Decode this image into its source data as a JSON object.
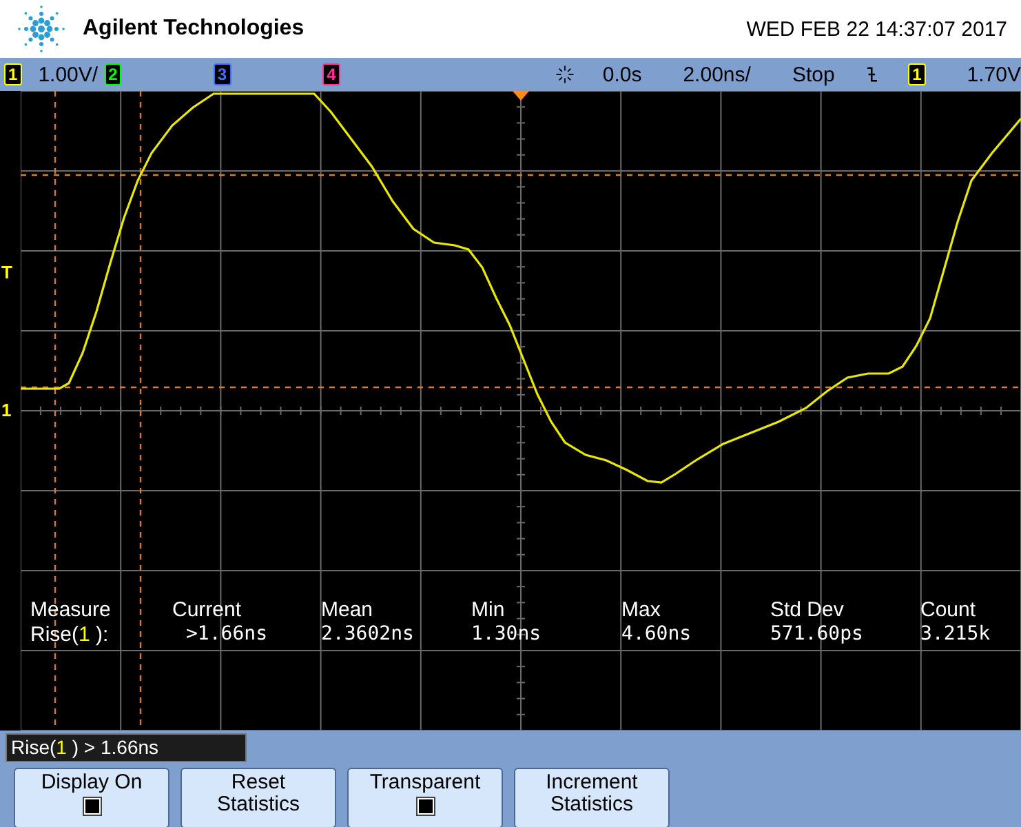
{
  "header": {
    "brand": "Agilent Technologies",
    "datetime": "WED FEB 22 14:37:07 2017"
  },
  "status_bar": {
    "channels": [
      {
        "label": "1",
        "color": "#ffff00",
        "scale": "1.00V/"
      },
      {
        "label": "2",
        "color": "#00ff00"
      },
      {
        "label": "3",
        "color": "#3b6cff"
      },
      {
        "label": "4",
        "color": "#ff2e9a"
      }
    ],
    "delay": "0.0s",
    "timebase": "2.00ns/",
    "run_state": "Stop",
    "trigger": {
      "channel": "1",
      "color": "#ffff00",
      "level": "1.70V"
    }
  },
  "screen": {
    "markers": [
      {
        "label": "T",
        "kind": "trigger"
      },
      {
        "label": "1",
        "kind": "ground"
      }
    ],
    "measurements": {
      "headers": [
        "Measure",
        "Current",
        "Mean",
        "Min",
        "Max",
        "Std Dev",
        "Count"
      ],
      "rows": [
        {
          "name": "Rise(",
          "channel": "1",
          "suffix": " ):",
          "values": [
            ">1.66ns",
            "2.3602ns",
            "1.30ns",
            "4.60ns",
            "571.60ps",
            "3.215k"
          ]
        }
      ]
    }
  },
  "result_bar": {
    "prefix": "Rise(",
    "channel": "1",
    "suffix": " ) > 1.66ns"
  },
  "softkeys": [
    {
      "label": "Display On",
      "kind": "checkbox",
      "checked": true
    },
    {
      "label": "Reset Statistics",
      "kind": "action"
    },
    {
      "label": "Transparent",
      "kind": "checkbox",
      "checked": true
    },
    {
      "label": "Increment Statistics",
      "kind": "action"
    }
  ]
}
